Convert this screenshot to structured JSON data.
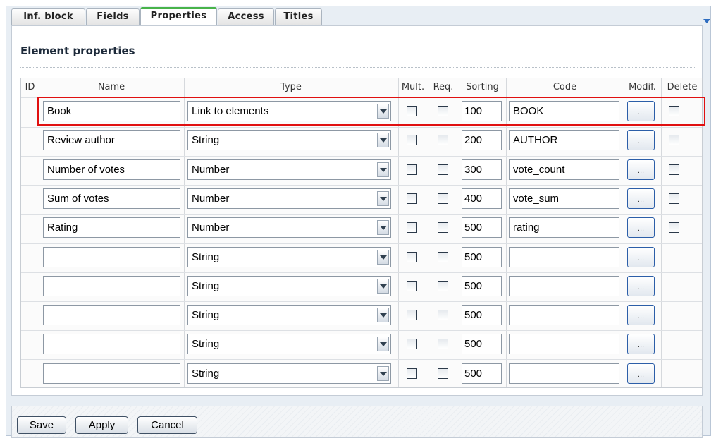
{
  "tabs": [
    {
      "label": "Inf. block",
      "active": false
    },
    {
      "label": "Fields",
      "active": false
    },
    {
      "label": "Properties",
      "active": true
    },
    {
      "label": "Access",
      "active": false
    },
    {
      "label": "Titles",
      "active": false
    }
  ],
  "panel": {
    "title": "Element properties"
  },
  "columns": {
    "id": "ID",
    "name": "Name",
    "type": "Type",
    "mult": "Mult.",
    "req": "Req.",
    "sorting": "Sorting",
    "code": "Code",
    "modif": "Modif.",
    "delete": "Delete"
  },
  "rows": [
    {
      "name": "Book",
      "type": "Link to elements",
      "sorting": "100",
      "code": "BOOK",
      "modif": "...",
      "has_delete": true,
      "highlighted": true
    },
    {
      "name": "Review author",
      "type": "String",
      "sorting": "200",
      "code": "AUTHOR",
      "modif": "...",
      "has_delete": true
    },
    {
      "name": "Number of votes",
      "type": "Number",
      "sorting": "300",
      "code": "vote_count",
      "modif": "...",
      "has_delete": true
    },
    {
      "name": "Sum of votes",
      "type": "Number",
      "sorting": "400",
      "code": "vote_sum",
      "modif": "...",
      "has_delete": true
    },
    {
      "name": "Rating",
      "type": "Number",
      "sorting": "500",
      "code": "rating",
      "modif": "...",
      "has_delete": true
    },
    {
      "name": "",
      "type": "String",
      "sorting": "500",
      "code": "",
      "modif": "...",
      "has_delete": false
    },
    {
      "name": "",
      "type": "String",
      "sorting": "500",
      "code": "",
      "modif": "...",
      "has_delete": false
    },
    {
      "name": "",
      "type": "String",
      "sorting": "500",
      "code": "",
      "modif": "...",
      "has_delete": false
    },
    {
      "name": "",
      "type": "String",
      "sorting": "500",
      "code": "",
      "modif": "...",
      "has_delete": false
    },
    {
      "name": "",
      "type": "String",
      "sorting": "500",
      "code": "",
      "modif": "...",
      "has_delete": false
    }
  ],
  "footer": {
    "save_label": "Save",
    "apply_label": "Apply",
    "cancel_label": "Cancel"
  },
  "colors": {
    "active_tab_accent": "#48b34a",
    "highlight_border": "#e01010",
    "tab_menu_arrow": "#2e6dc0"
  }
}
